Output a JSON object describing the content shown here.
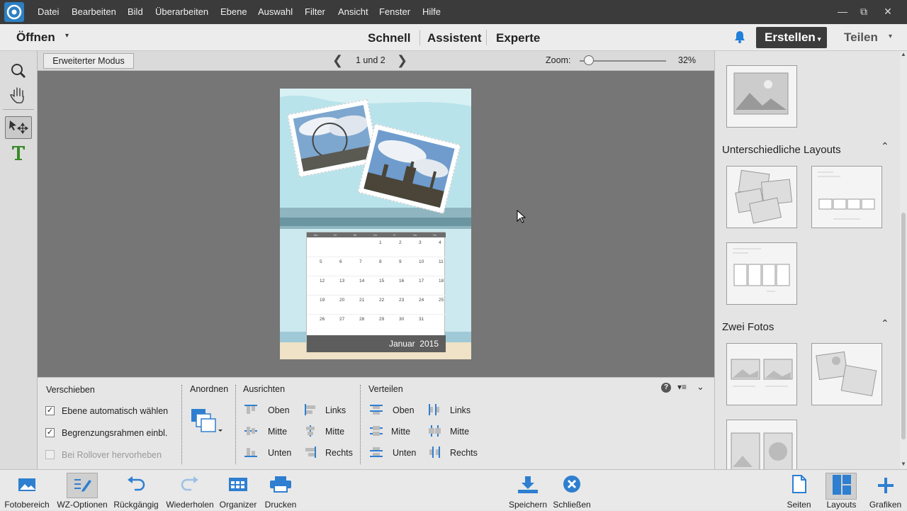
{
  "menubar": {
    "items": [
      "Datei",
      "Bearbeiten",
      "Bild",
      "Überarbeiten",
      "Ebene",
      "Auswahl",
      "Filter",
      "Ansicht",
      "Fenster",
      "Hilfe"
    ]
  },
  "modebar": {
    "open_label": "Öffnen",
    "modes": [
      "Schnell",
      "Assistent",
      "Experte"
    ],
    "create_label": "Erstellen",
    "share_label": "Teilen"
  },
  "optbar": {
    "mode_button": "Erweiterter Modus",
    "page_indicator": "1 und 2",
    "zoom_label": "Zoom:",
    "zoom_value": "32%",
    "zoom_fraction": 0.05
  },
  "calendar": {
    "weekday_headers": [
      "Mo",
      "Di",
      "Mi",
      "Do",
      "Fr",
      "Sa",
      "So"
    ],
    "rows": [
      [
        "",
        "",
        "",
        "1",
        "2",
        "3",
        "4"
      ],
      [
        "5",
        "6",
        "7",
        "8",
        "9",
        "10",
        "11"
      ],
      [
        "12",
        "13",
        "14",
        "15",
        "16",
        "17",
        "18"
      ],
      [
        "19",
        "20",
        "21",
        "22",
        "23",
        "24",
        "25"
      ],
      [
        "26",
        "27",
        "28",
        "29",
        "30",
        "31",
        ""
      ]
    ],
    "month_label": "Januar  2015"
  },
  "props": {
    "move_title": "Verschieben",
    "auto_select": "Ebene automatisch wählen",
    "show_bbox": "Begrenzungsrahmen einbl.",
    "rollover": "Bei Rollover hervorheben",
    "arrange_title": "Anordnen",
    "align_title": "Ausrichten",
    "align_items": [
      "Oben",
      "Links",
      "Mitte",
      "Mitte",
      "Unten",
      "Rechts"
    ],
    "distribute_title": "Verteilen",
    "distribute_items": [
      "Oben",
      "Links",
      "Mitte",
      "Mitte",
      "Unten",
      "Rechts"
    ]
  },
  "rpanel": {
    "section_layouts": "Unterschiedliche Layouts",
    "section_two_photos": "Zwei Fotos"
  },
  "bottombar": {
    "left": [
      "Fotobereich",
      "WZ-Optionen",
      "Rückgängig",
      "Wiederholen",
      "Organizer",
      "Drucken"
    ],
    "center": [
      "Speichern",
      "Schließen"
    ],
    "right": [
      "Seiten",
      "Layouts",
      "Grafiken"
    ]
  }
}
